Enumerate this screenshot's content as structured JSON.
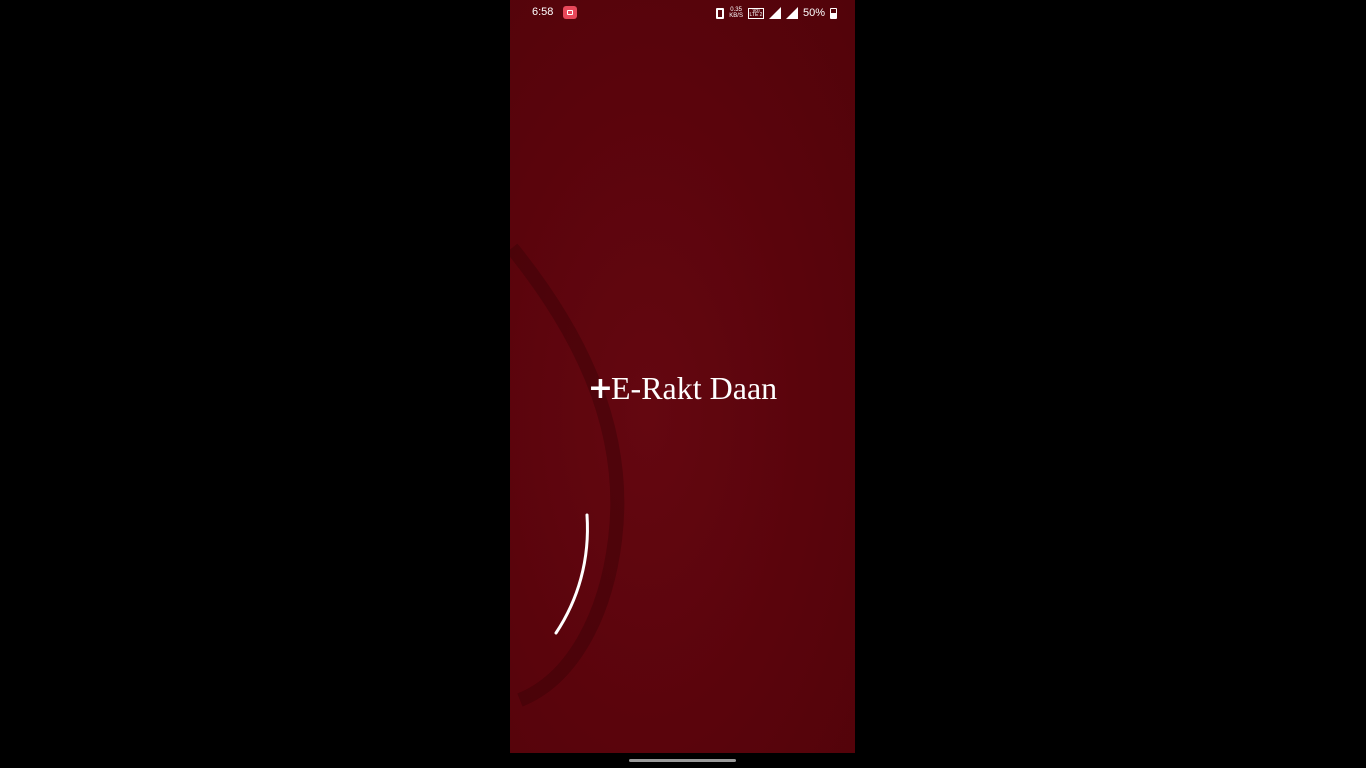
{
  "status_bar": {
    "time": "6:58",
    "netspeed_value": "0.35",
    "netspeed_unit": "KB/S",
    "volte_label": "Vo) LTE 2",
    "battery": "50%",
    "icons": [
      "screen-recorder-icon",
      "vibrate-icon",
      "volte-icon",
      "signal-icon",
      "battery-icon"
    ]
  },
  "splash": {
    "logo_symbol": "+",
    "app_name": "E-Rakt Daan"
  },
  "colors": {
    "background": "#5a040c",
    "outer": "#000000",
    "text": "#ffffff",
    "recorder_badge": "#e8485a"
  }
}
